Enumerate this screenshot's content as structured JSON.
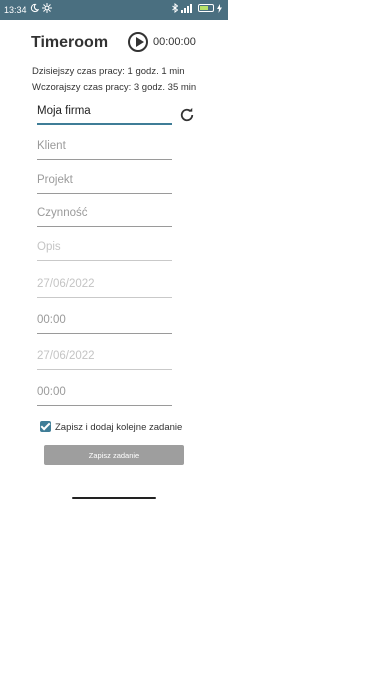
{
  "status_bar": {
    "time": "13:34",
    "icons_left": [
      "moon-icon",
      "settings-icon"
    ],
    "icons_right": [
      "bluetooth-icon",
      "signal-icon",
      "battery-icon",
      "charging-icon"
    ],
    "battery_level": 0.7,
    "bg_color": "#4a6f80"
  },
  "header": {
    "title": "Timeroom",
    "timer": "00:00:00"
  },
  "worktime": {
    "today": "Dzisiejszy czas pracy: 1 godz. 1 min",
    "yesterday": "Wczorajszy czas pracy: 3 godz. 35 min"
  },
  "form": {
    "company": "Moja firma",
    "client_placeholder": "Klient",
    "project_placeholder": "Projekt",
    "activity_placeholder": "Czynność",
    "description_placeholder": "Opis",
    "start_date": "27/06/2022",
    "start_time": "00:00",
    "end_date": "27/06/2022",
    "end_time": "00:00",
    "add_next_label": "Zapisz i dodaj kolejne zadanie",
    "add_next_checked": true,
    "submit_label": "Zapisz zadanie"
  },
  "colors": {
    "accent": "#3f7d97",
    "button": "#9e9e9e"
  }
}
